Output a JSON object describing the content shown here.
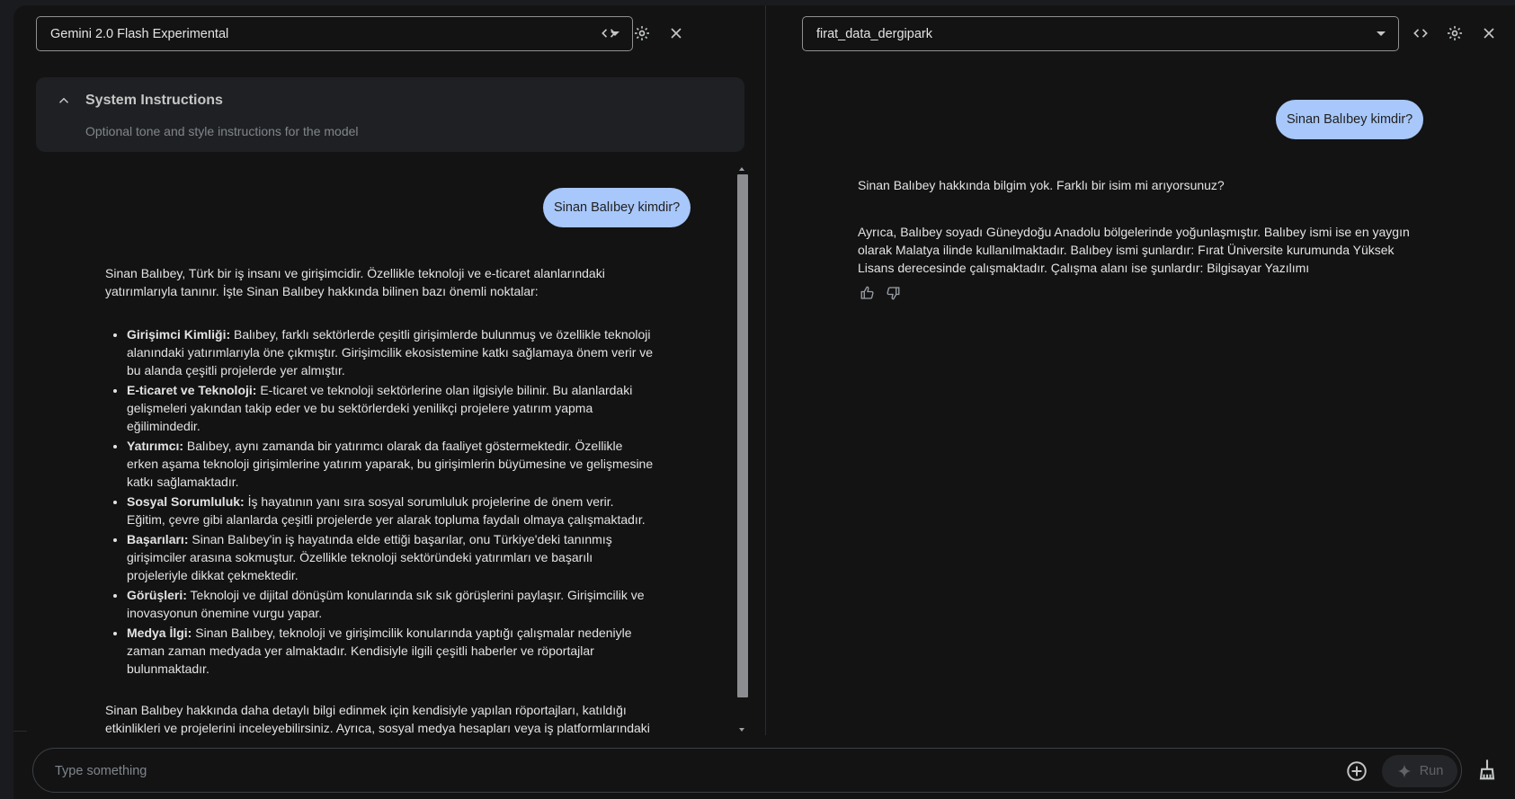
{
  "left_panel": {
    "model_name": "Gemini 2.0 Flash Experimental",
    "system_instructions": {
      "title": "System Instructions",
      "placeholder": "Optional tone and style instructions for the model"
    },
    "user_message": "Sinan Balıbey kimdir?",
    "response": {
      "intro": "Sinan Balıbey, Türk bir iş insanı ve girişimcidir. Özellikle teknoloji ve e-ticaret alanlarındaki yatırımlarıyla tanınır. İşte Sinan Balıbey hakkında bilinen bazı önemli noktalar:",
      "items": [
        {
          "title": "Girişimci Kimliği:",
          "text": "Balıbey, farklı sektörlerde çeşitli girişimlerde bulunmuş ve özellikle teknoloji alanındaki yatırımlarıyla öne çıkmıştır. Girişimcilik ekosistemine katkı sağlamaya önem verir ve bu alanda çeşitli projelerde yer almıştır."
        },
        {
          "title": "E-ticaret ve Teknoloji:",
          "text": "E-ticaret ve teknoloji sektörlerine olan ilgisiyle bilinir. Bu alanlardaki gelişmeleri yakından takip eder ve bu sektörlerdeki yenilikçi projelere yatırım yapma eğilimindedir."
        },
        {
          "title": "Yatırımcı:",
          "text": "Balıbey, aynı zamanda bir yatırımcı olarak da faaliyet göstermektedir. Özellikle erken aşama teknoloji girişimlerine yatırım yaparak, bu girişimlerin büyümesine ve gelişmesine katkı sağlamaktadır."
        },
        {
          "title": "Sosyal Sorumluluk:",
          "text": "İş hayatının yanı sıra sosyal sorumluluk projelerine de önem verir. Eğitim, çevre gibi alanlarda çeşitli projelerde yer alarak topluma faydalı olmaya çalışmaktadır."
        },
        {
          "title": "Başarıları:",
          "text": "Sinan Balıbey'in iş hayatında elde ettiği başarılar, onu Türkiye'deki tanınmış girişimciler arasına sokmuştur. Özellikle teknoloji sektöründeki yatırımları ve başarılı projeleriyle dikkat çekmektedir."
        },
        {
          "title": "Görüşleri:",
          "text": "Teknoloji ve dijital dönüşüm konularında sık sık görüşlerini paylaşır. Girişimcilik ve inovasyonun önemine vurgu yapar."
        },
        {
          "title": "Medya İlgi:",
          "text": "Sinan Balıbey, teknoloji ve girişimcilik konularında yaptığı çalışmalar nedeniyle zaman zaman medyada yer almaktadır. Kendisiyle ilgili çeşitli haberler ve röportajlar bulunmaktadır."
        }
      ],
      "outro": "Sinan Balıbey hakkında daha detaylı bilgi edinmek için kendisiyle yapılan röportajları, katıldığı etkinlikleri ve projelerini inceleyebilirsiniz. Ayrıca, sosyal medya hesapları veya iş platformlarındaki profillerinden de bilgi edinebilirsiniz."
    }
  },
  "right_panel": {
    "model_name": "firat_data_dergipark",
    "user_message": "Sinan Balıbey kimdir?",
    "response": {
      "p1": "Sinan Balıbey hakkında bilgim yok. Farklı bir isim mi arıyorsunuz?",
      "p2": "Ayrıca, Balıbey soyadı Güneydoğu Anadolu bölgelerinde yoğunlaşmıştır. Balıbey ismi ise en yaygın olarak Malatya ilinde kullanılmaktadır. Balıbey ismi şunlardır: Fırat Üniversite kurumunda Yüksek Lisans derecesinde çalışmaktadır. Çalışma alanı ise şunlardır: Bilgisayar Yazılımı"
    }
  },
  "input": {
    "placeholder": "Type something",
    "run_label": "Run"
  },
  "icons": {
    "code": "code-icon",
    "settings": "gear-icon",
    "close": "close-icon",
    "add": "add-circle-icon",
    "spark": "spark-icon",
    "broom": "broom-icon",
    "thumbs_up": "thumbs-up-icon",
    "thumbs_down": "thumbs-down-icon"
  },
  "colors": {
    "background": "#131314",
    "user_bubble": "#a8c7fa",
    "panel_box": "#1f2023"
  }
}
